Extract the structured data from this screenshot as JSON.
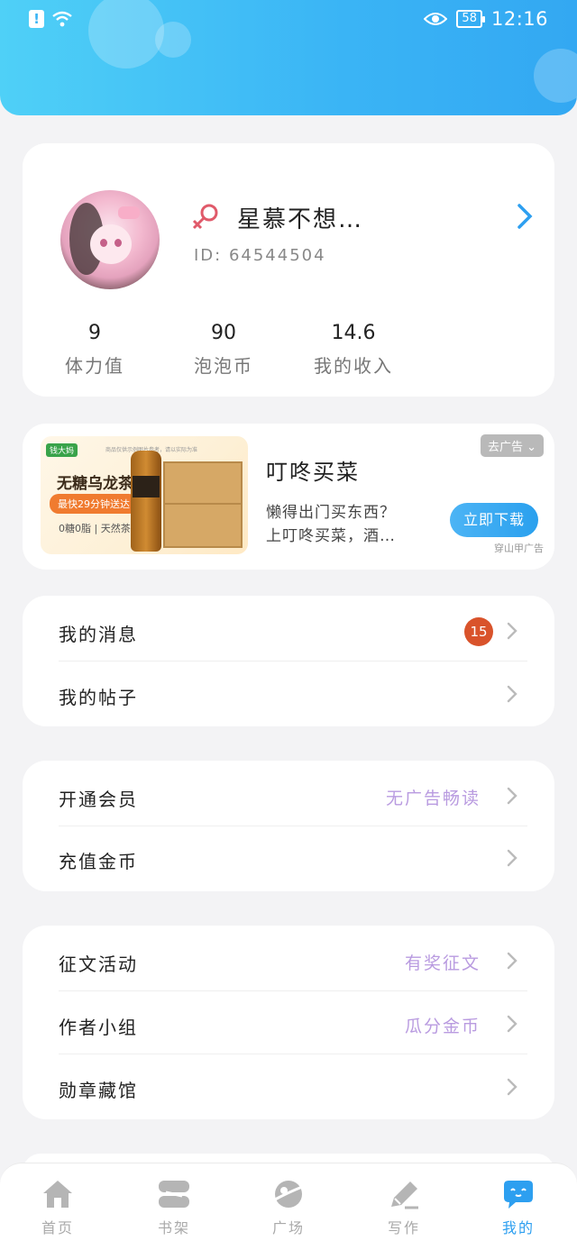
{
  "status_bar": {
    "alert_glyph": "!",
    "battery": "58",
    "time": "12:16"
  },
  "profile": {
    "username": "星慕不想…",
    "user_id": "ID: 64544504",
    "stats": [
      {
        "value": "9",
        "label": "体力值"
      },
      {
        "value": "90",
        "label": "泡泡币"
      },
      {
        "value": "14.6",
        "label": "我的收入"
      }
    ]
  },
  "ad": {
    "image_logo": "钱大妈",
    "image_small_print": "商品仅供示例图片参考，请以实际为准",
    "image_title": "无糖乌龙茶",
    "image_pill": "最快29分钟送达",
    "image_sub": "0糖0脂 | 天然茶叶",
    "title": "叮咚买菜",
    "desc_line1": "懒得出门买东西？",
    "desc_line2": "上叮咚买菜，酒…",
    "close_label": "去广告",
    "button_label": "立即下载",
    "tag": "穿山甲广告"
  },
  "menu_group_1": [
    {
      "label": "我的消息",
      "badge": "15"
    },
    {
      "label": "我的帖子"
    }
  ],
  "menu_group_2": [
    {
      "label": "开通会员",
      "sub": "无广告畅读"
    },
    {
      "label": "充值金币"
    }
  ],
  "menu_group_3": [
    {
      "label": "征文活动",
      "sub": "有奖征文"
    },
    {
      "label": "作者小组",
      "sub": "瓜分金币"
    },
    {
      "label": "勋章藏馆"
    }
  ],
  "tabs": [
    {
      "label": "首页",
      "icon": "home-icon"
    },
    {
      "label": "书架",
      "icon": "bookshelf-icon"
    },
    {
      "label": "广场",
      "icon": "planet-icon"
    },
    {
      "label": "写作",
      "icon": "pen-icon"
    },
    {
      "label": "我的",
      "icon": "chat-bubble-icon"
    }
  ],
  "colors": {
    "accent": "#2d9ff0",
    "header_gradient_start": "#4fd0f7",
    "header_gradient_end": "#33a8f2",
    "menu_sub_text": "#b99be0",
    "badge": "#d9532b",
    "gender_icon": "#e05a6a"
  }
}
